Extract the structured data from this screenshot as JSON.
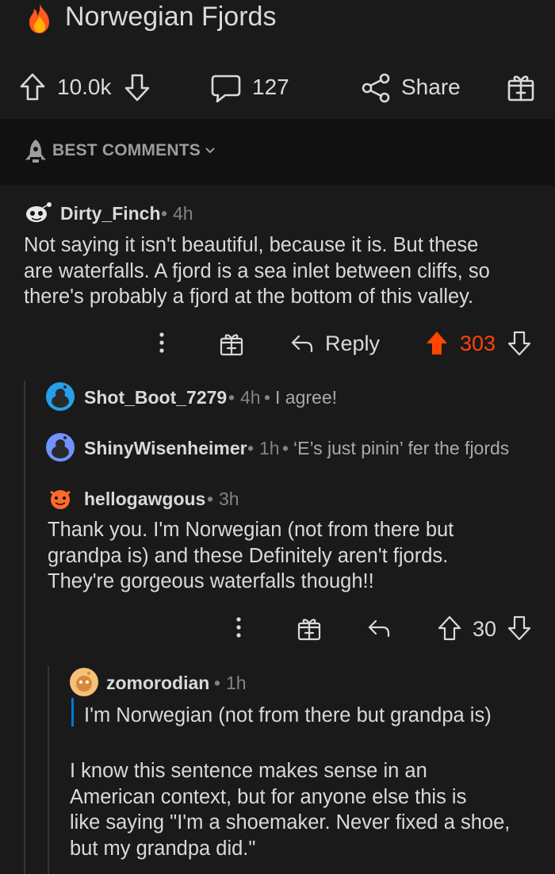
{
  "post": {
    "title": "Norwegian Fjords",
    "upvotes": "10.0k",
    "comments_count": "127",
    "share_label": "Share"
  },
  "sort": {
    "label": "BEST COMMENTS"
  },
  "comments": [
    {
      "username": "Dirty_Finch",
      "age": "4h",
      "body": [
        "Not saying it isn't beautiful, because it is. But these",
        "are waterfalls. A fjord is a sea inlet between cliffs, so",
        "there's probably a fjord at the bottom of this valley."
      ],
      "reply_label": "Reply",
      "score": "303",
      "score_color": "#ff4500"
    },
    {
      "username": "Shot_Boot_7279",
      "age": "4h",
      "inline_text": "I agree!"
    },
    {
      "username": "ShinyWisenheimer",
      "age": "1h",
      "inline_text": "‘E’s just pinin’ fer the fjords"
    },
    {
      "username": "hellogawgous",
      "age": "3h",
      "body": [
        "Thank you. I'm Norwegian (not from there but",
        "grandpa is) and these Definitely aren't fjords.",
        "They're gorgeous waterfalls though!!"
      ],
      "score": "30"
    },
    {
      "username": "zomorodian",
      "age": "1h",
      "quote": "I'm Norwegian (not from there but grandpa is)",
      "body": [
        "I know this sentence makes sense in an",
        "American context, but for anyone else this is",
        "like saying \"I'm a shoemaker. Never fixed a shoe,",
        "but my grandpa did.\""
      ]
    }
  ],
  "separator": "•",
  "icons": {
    "title": "fire-icon",
    "upvote": "arrow-up-icon",
    "downvote": "arrow-down-icon",
    "comments": "speech-bubble-icon",
    "share": "share-icon",
    "award": "gift-icon",
    "sort": "rocket-icon",
    "more": "vertical-dots-icon",
    "reply": "reply-arrow-icon"
  },
  "colors": {
    "background": "#1a1a1b",
    "sort_bar": "#111112",
    "upvoted": "#ff4500",
    "quote_bar": "#0079d3"
  }
}
